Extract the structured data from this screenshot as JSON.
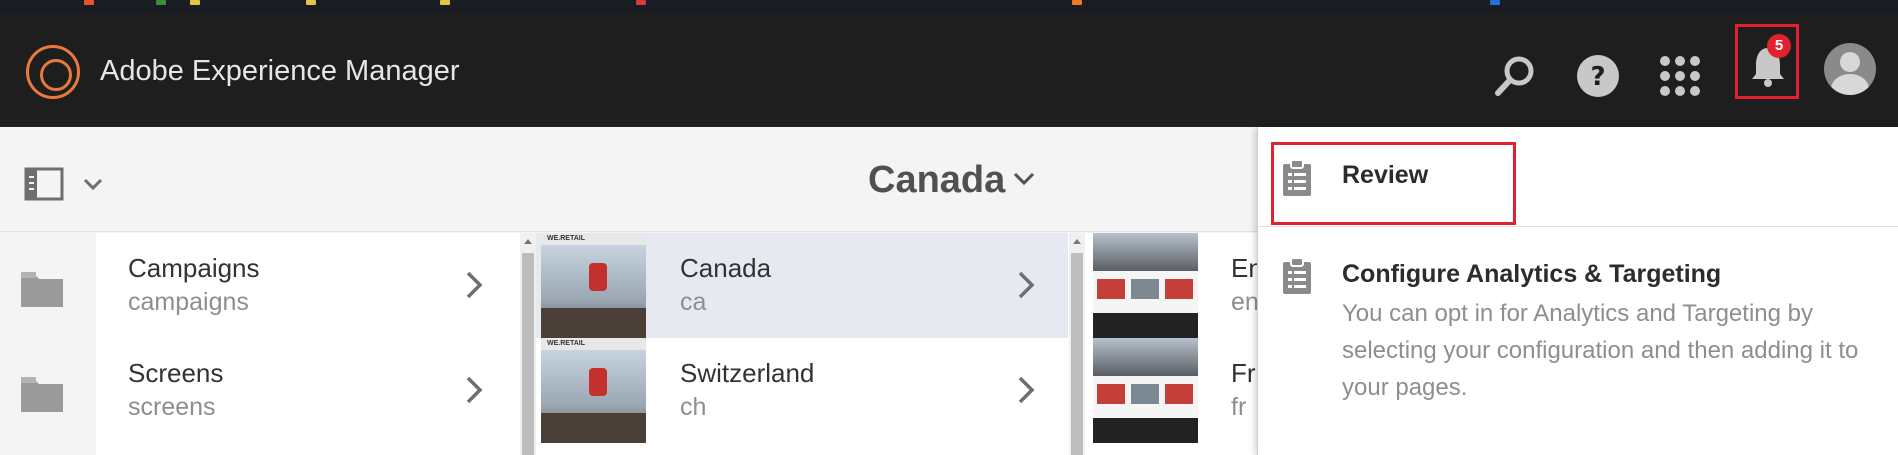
{
  "shell": {
    "app_title": "Adobe Experience Manager",
    "notification_count": "5",
    "accent_color": "#e87a3d",
    "badge_color": "#e1222e"
  },
  "toolbar": {
    "location_title": "Canada"
  },
  "columns": {
    "folders": [
      {
        "title": "Campaigns",
        "name": "campaigns"
      },
      {
        "title": "Screens",
        "name": "screens"
      }
    ],
    "sites": [
      {
        "title": "Canada",
        "name": "ca",
        "selected": true
      },
      {
        "title": "Switzerland",
        "name": "ch",
        "selected": false
      }
    ],
    "languages": [
      {
        "title": "En",
        "name": "en"
      },
      {
        "title": "Fr",
        "name": "fr"
      }
    ],
    "thumbnail_brand": "WE.RETAIL"
  },
  "notifications": {
    "items": [
      {
        "title": "Review",
        "description": ""
      },
      {
        "title": "Configure Analytics & Targeting",
        "description": "You can opt in for Analytics and Targeting by selecting your configuration and then adding it to your pages."
      }
    ]
  }
}
